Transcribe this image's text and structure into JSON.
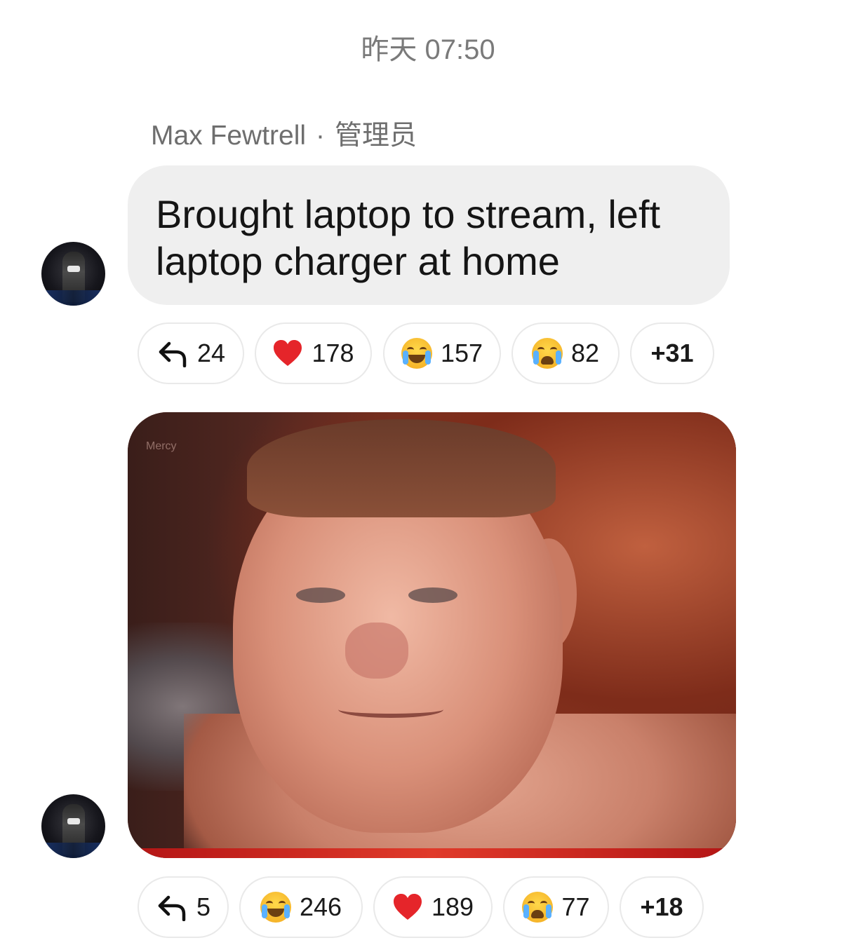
{
  "timestamp": "昨天 07:50",
  "sender": {
    "name": "Max Fewtrell",
    "separator": "·",
    "role": "管理员"
  },
  "message": {
    "text": "Brought laptop to stream, left laptop charger at home"
  },
  "reactions_1": [
    {
      "icon": "reply-icon",
      "count": "24"
    },
    {
      "icon": "heart-icon",
      "count": "178"
    },
    {
      "icon": "laugh-crying-icon",
      "count": "157"
    },
    {
      "icon": "loudly-crying-icon",
      "count": "82"
    },
    {
      "more": "+31"
    }
  ],
  "image": {
    "watermark": "Mercy"
  },
  "reactions_2": [
    {
      "icon": "reply-icon",
      "count": "5"
    },
    {
      "icon": "laugh-crying-icon",
      "count": "246"
    },
    {
      "icon": "heart-icon",
      "count": "189"
    },
    {
      "icon": "loudly-crying-icon",
      "count": "77"
    },
    {
      "more": "+18"
    }
  ],
  "colors": {
    "bubble": "#efefef",
    "heart": "#e5252a"
  }
}
